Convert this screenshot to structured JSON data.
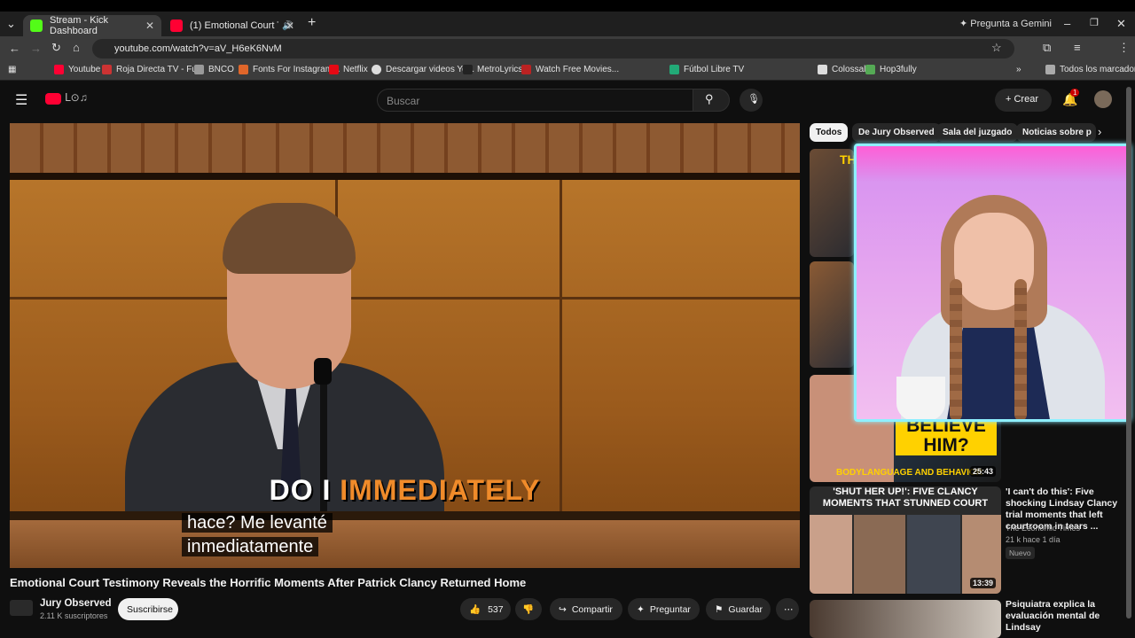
{
  "browser": {
    "tabs": [
      {
        "title": "Stream - Kick Dashboard",
        "active": true
      },
      {
        "title": "(1) Emotional Court Testimo",
        "active": false
      }
    ],
    "gemini": "Pregunta a Gemini",
    "url": "youtube.com/watch?v=aV_H6eK6NvM",
    "bookmarks": [
      "Youtube",
      "Roja Directa TV - Fu...",
      "BNCO",
      "Fonts For Instagram...",
      "Netflix",
      "Descargar videos Yo...",
      "MetroLyrics",
      "Watch Free Movies...",
      "Fútbol Libre TV",
      "Colossal",
      "Hop3fully"
    ],
    "all_bookmarks": "Todos los marcadores"
  },
  "youtube": {
    "search_placeholder": "Buscar",
    "create_label": "Crear",
    "notif_count": "1"
  },
  "video": {
    "caption_white": "DO I",
    "caption_orange": "IMMEDIATELY",
    "subtitle_line1": "hace?  Me levanté",
    "subtitle_line2": "inmediatamente",
    "title": "Emotional Court Testimony Reveals the Horrific Moments After Patrick Clancy Returned Home",
    "channel": "Jury Observed",
    "subscribers": "2.11 K suscriptores",
    "subscribe_label": "Suscribirse",
    "likes": "537",
    "share_label": "Compartir",
    "ask_label": "Preguntar",
    "save_label": "Guardar"
  },
  "chips": [
    "Todos",
    "De Jury Observed",
    "Sala del juzgado",
    "Noticias sobre p"
  ],
  "related": [
    {
      "overlay": "BELIEVE HIM?",
      "overlay2": "BODYLANGUAGE AND BEHAVIOR",
      "duration": "25:43"
    },
    {
      "overlay": "'SHUT HER UP!': FIVE CLANCY MOMENTS THAT STUNNED COURT",
      "duration": "13:39",
      "title": "'I can't do this': Five shocking Lindsay Clancy trial moments that left courtroom in tears ...",
      "channel": "The Economic Times",
      "meta": "21 k  hace 1 día",
      "badge": "Nuevo"
    },
    {
      "title": "Psiquiatra explica la evaluación mental de Lindsay"
    }
  ],
  "colors": {
    "accent": "#f08b2a",
    "cam_border": "#8ef0ff",
    "yt_red": "#ff0033"
  }
}
